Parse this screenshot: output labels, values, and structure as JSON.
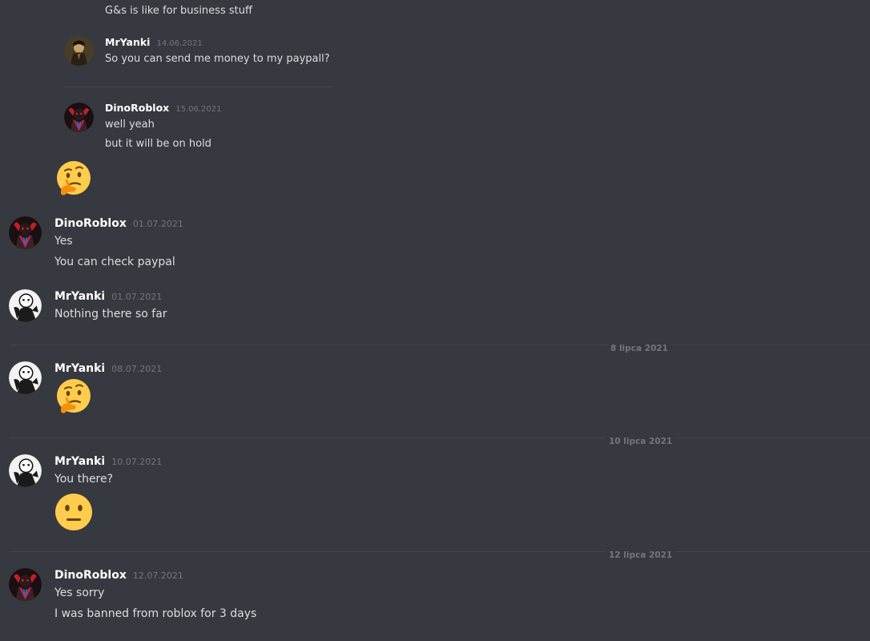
{
  "quoted": {
    "line_prev": "G&s is like for business stuff",
    "msg1": {
      "author": "MrYanki",
      "timestamp": "14.06.2021",
      "text": "So you can send me money to my paypall?"
    },
    "msg2": {
      "author": "DinoRoblox",
      "timestamp": "15.06.2021",
      "lines": [
        "well yeah",
        "but it will be on hold"
      ]
    },
    "reaction_emoji": "thinking-face"
  },
  "messages": [
    {
      "author": "DinoRoblox",
      "timestamp": "01.07.2021",
      "lines": [
        "Yes",
        "You can check paypal"
      ]
    },
    {
      "author": "MrYanki",
      "timestamp": "01.07.2021",
      "lines": [
        "Nothing there so far"
      ]
    },
    {
      "author": "MrYanki",
      "timestamp": "08.07.2021",
      "emoji": "thinking-face"
    },
    {
      "author": "MrYanki",
      "timestamp": "10.07.2021",
      "lines": [
        "You there?"
      ],
      "emoji": "neutral-face"
    },
    {
      "author": "DinoRoblox",
      "timestamp": "12.07.2021",
      "lines": [
        "Yes sorry",
        "I was banned from roblox for 3 days"
      ]
    }
  ],
  "dividers": [
    "8 lipca 2021",
    "10 lipca 2021",
    "12 lipca 2021"
  ],
  "colors": {
    "background": "#36393f",
    "username": "#ffffff",
    "timestamp": "#72767d",
    "text": "#dcddde",
    "divider": "#42454a"
  }
}
